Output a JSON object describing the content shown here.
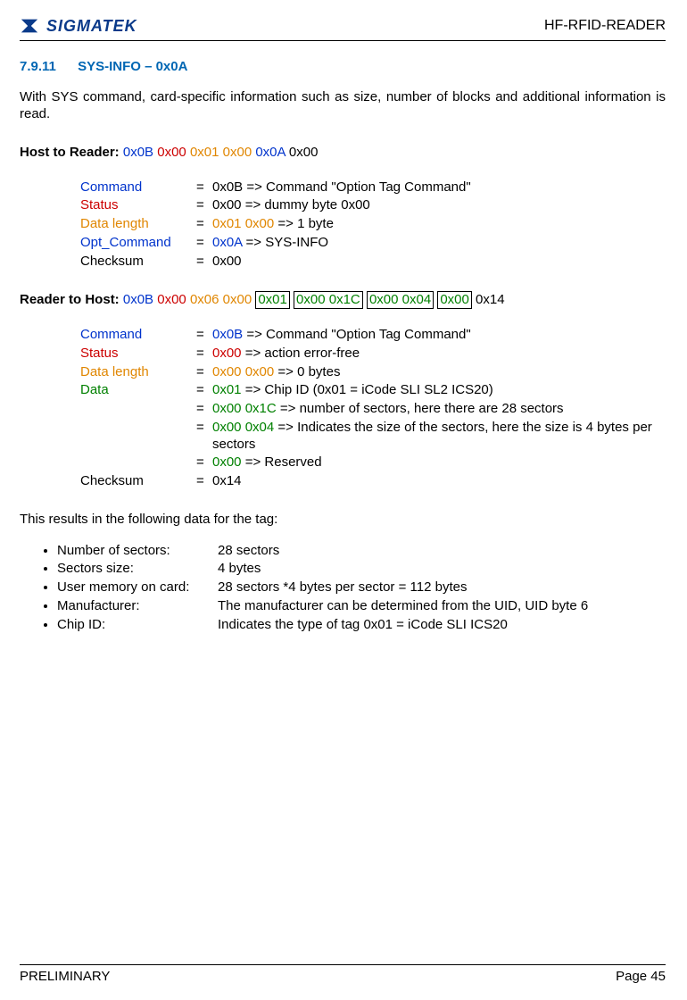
{
  "header": {
    "logo_text": "SIGMATEK",
    "doc_title": "HF-RFID-READER"
  },
  "heading": {
    "num": "7.9.11",
    "title": "SYS-INFO – 0x0A"
  },
  "intro": "With SYS command, card-specific information such as size, number of blocks and additional information is read.",
  "h2r": {
    "label": "Host to Reader: ",
    "bytes": {
      "b1": "0x0B",
      "b2": "0x00",
      "b3": "0x01 0x00",
      "b4": "0x0A",
      "b5": "0x00"
    },
    "rows": {
      "command": {
        "label": "Command",
        "val": " 0x0B   => Command \"Option Tag Command\""
      },
      "status": {
        "label": "Status",
        "val": " 0x00   => dummy byte 0x00"
      },
      "datalen": {
        "label": "Data length",
        "val_pre": " 0x01 0x00 ",
        "val_post": "=> 1 byte"
      },
      "optcmd": {
        "label": "Opt_Command",
        "val_pre": " 0x0A ",
        "val_post": "=> SYS-INFO"
      },
      "checksum": {
        "label": "Checksum",
        "val": " 0x00"
      }
    }
  },
  "r2h": {
    "label": "Reader to Host: ",
    "bytes": {
      "b1": "0x0B",
      "b2": "0x00",
      "b3": "0x06 0x00",
      "b4": "0x01",
      "b5": "0x00 0x1C",
      "b6": "0x00 0x04",
      "b7": "0x00",
      "b8": "0x14"
    },
    "rows": {
      "command": {
        "label": "Command",
        "val_pre": " 0x0B ",
        "val_post": "=> Command \"Option Tag Command\""
      },
      "status": {
        "label": "Status",
        "val_pre": " 0x00 ",
        "val_post": "=> action error-free"
      },
      "datalen": {
        "label": "Data length",
        "val_pre": "  0x00 0x00 ",
        "val_post": "=> 0 bytes"
      },
      "data1": {
        "label": "Data",
        "pre": " 0x01 ",
        "post": "=> Chip ID (0x01 = iCode SLI SL2 ICS20)"
      },
      "data2": {
        "pre": " 0x00 0x1C ",
        "post": "=> number of sectors, here there are 28 sectors"
      },
      "data3": {
        "pre": " 0x00 0x04 ",
        "post": "=> Indicates the size of the sectors, here the size is 4 bytes per sectors"
      },
      "data4": {
        "pre": " 0x00 ",
        "post": "=> Reserved"
      },
      "checksum": {
        "label": "Checksum",
        "val": " 0x14"
      }
    }
  },
  "results_title": "This results in the following data for the tag:",
  "bullets": [
    {
      "label": "Number of sectors:",
      "val": "28 sectors"
    },
    {
      "label": "Sectors size:",
      "val": "4 bytes"
    },
    {
      "label": "User memory on card:",
      "val": "28 sectors *4 bytes per sector = 112 bytes"
    },
    {
      "label": "Manufacturer:",
      "val": "The manufacturer can be determined from the UID, UID byte 6"
    },
    {
      "label": "Chip ID:",
      "val": "Indicates the type of tag 0x01 = iCode SLI ICS20"
    }
  ],
  "footer": {
    "left": "PRELIMINARY",
    "right": "Page 45"
  }
}
